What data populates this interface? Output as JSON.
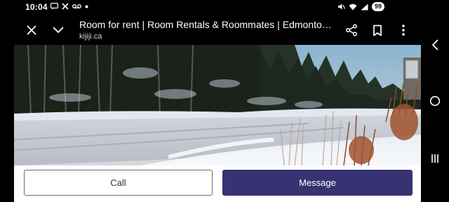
{
  "status_bar": {
    "time": "10:04",
    "battery": "99",
    "left_icons": [
      "message-icon",
      "cross-icon",
      "voicemail-icon",
      "dot-icon"
    ],
    "right_icons": [
      "mute-icon",
      "wifi-icon",
      "signal-icon",
      "battery-icon"
    ]
  },
  "browser": {
    "title": "Room for rent | Room Rentals & Roommates | Edmonton | ...",
    "domain": "kijiji.ca"
  },
  "listing": {
    "photo_icon": "snowy-street-photo",
    "call_label": "Call",
    "message_label": "Message"
  },
  "colors": {
    "message_button": "#373373",
    "background": "#000000"
  },
  "nav_bar": {
    "icons": [
      "back-icon",
      "home-icon",
      "recents-icon"
    ]
  }
}
